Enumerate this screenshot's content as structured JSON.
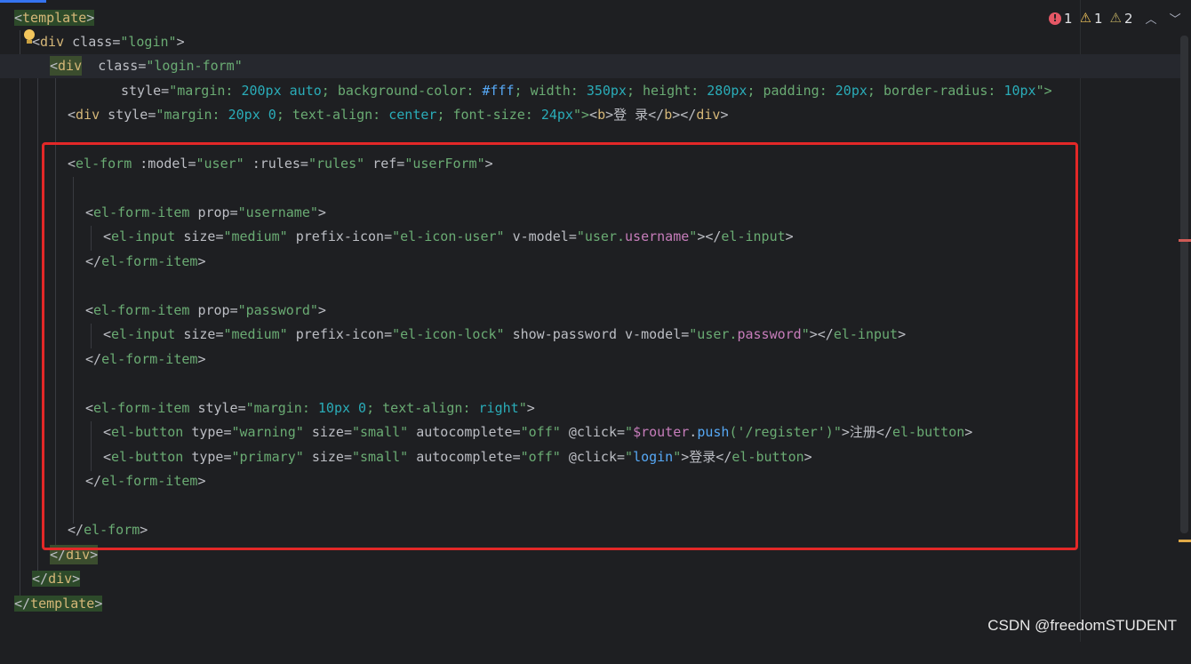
{
  "inspections": {
    "errors": "1",
    "warnings": "1",
    "weak_warnings": "2",
    "colors": {
      "error": "#e55765",
      "warning": "#f2c55c",
      "weak_warning": "#b9a85f"
    }
  },
  "code": {
    "l1_tag": "template",
    "l2_tag": "div",
    "l2_attr": "class",
    "l2_val": "\"login\"",
    "l3_tag": "div",
    "l3_attr": "class",
    "l3_val": "\"login-form\"",
    "l4_attr": "style",
    "l4_p1": "\"margin: ",
    "l4_n1": "200px auto",
    "l4_p2": "; background-color: ",
    "l4_n2": "#fff",
    "l4_p3": "; width: ",
    "l4_n3": "350px",
    "l4_p4": "; height: ",
    "l4_n4": "280px",
    "l4_p5": "; padding: ",
    "l4_n5": "20px",
    "l4_p6": "; border-radius: ",
    "l4_n6": "10px",
    "l4_end": "\">",
    "l5_tag": "div",
    "l5_attr": "style",
    "l5_p1": "\"margin: ",
    "l5_n1": "20px 0",
    "l5_p2": "; text-align: ",
    "l5_n2": "center",
    "l5_p3": "; font-size: ",
    "l5_n3": "24px",
    "l5_p4": "\">",
    "l5_btag": "b",
    "l5_text": "登 录",
    "l5_end_b": "b",
    "l5_end_div": "div",
    "l6_tag": "el-form",
    "l6_a1": ":model",
    "l6_v1": "\"user\"",
    "l6_a2": ":rules",
    "l6_v2": "\"rules\"",
    "l6_a3": "ref",
    "l6_v3": "\"userForm\"",
    "l7_tag": "el-form-item",
    "l7_a1": "prop",
    "l7_v1": "\"username\"",
    "l8_tag": "el-input",
    "l8_a1": "size",
    "l8_v1": "\"medium\"",
    "l8_a2": "prefix-icon",
    "l8_v2": "\"el-icon-user\"",
    "l8_a3": "v-model",
    "l8_v3a": "\"user.",
    "l8_v3b": "username",
    "l8_v3c": "\"",
    "l8_end": "el-input",
    "l9_tag": "el-form-item",
    "l10_tag": "el-form-item",
    "l10_a1": "prop",
    "l10_v1": "\"password\"",
    "l11_tag": "el-input",
    "l11_a1": "size",
    "l11_v1": "\"medium\"",
    "l11_a2": "prefix-icon",
    "l11_v2": "\"el-icon-lock\"",
    "l11_a3": "show-password",
    "l11_a4": "v-model",
    "l11_v4a": "\"user.",
    "l11_v4b": "password",
    "l11_v4c": "\"",
    "l11_end": "el-input",
    "l12_tag": "el-form-item",
    "l13_tag": "el-form-item",
    "l13_a1": "style",
    "l13_p1": "\"margin: ",
    "l13_n1": "10px 0",
    "l13_p2": "; text-align: ",
    "l13_n2": "right",
    "l13_p3": "\"",
    "l14_tag": "el-button",
    "l14_a1": "type",
    "l14_v1": "\"warning\"",
    "l14_a2": "size",
    "l14_v2": "\"small\"",
    "l14_a3": "autocomplete",
    "l14_v3": "\"off\"",
    "l14_a4": "@click",
    "l14_v4a": "\"",
    "l14_v4b": "$router",
    "l14_v4c": ".",
    "l14_v4d": "push",
    "l14_v4e": "('/register')\"",
    "l14_text": "注册",
    "l14_end": "el-button",
    "l15_tag": "el-button",
    "l15_a1": "type",
    "l15_v1": "\"primary\"",
    "l15_a2": "size",
    "l15_v2": "\"small\"",
    "l15_a3": "autocomplete",
    "l15_v3": "\"off\"",
    "l15_a4": "@click",
    "l15_v4a": "\"",
    "l15_v4b": "login",
    "l15_v4c": "\"",
    "l15_text": "登录",
    "l15_end": "el-button",
    "l16_tag": "el-form-item",
    "l17_tag": "el-form",
    "l18_tag": "div",
    "l19_tag": "div",
    "l20_tag": "template"
  },
  "watermark": "CSDN @freedomSTUDENT",
  "colors": {
    "highlight_box": "#e32828",
    "background": "#1e1f22"
  }
}
